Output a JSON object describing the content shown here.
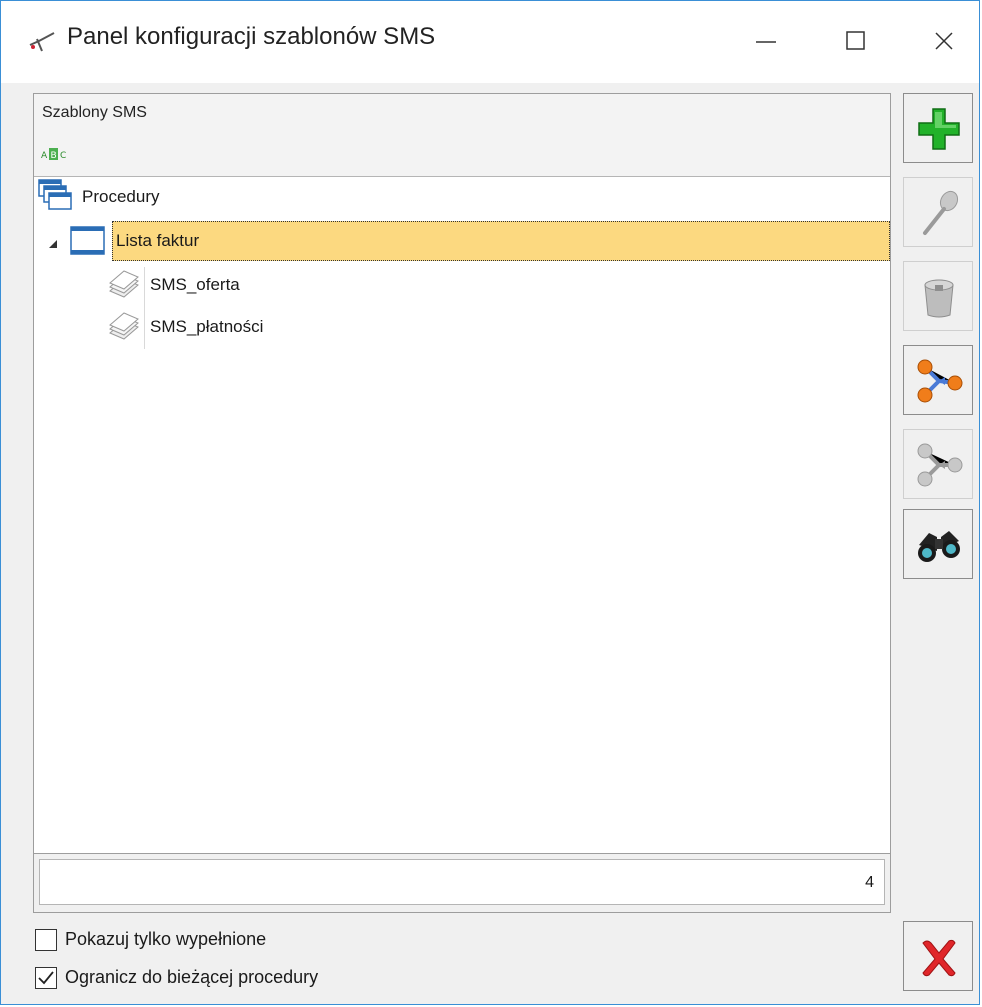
{
  "window": {
    "title": "Panel konfiguracji szablonów SMS"
  },
  "panel": {
    "header": "Szablony SMS",
    "tree": [
      {
        "label": "Procedury",
        "icon": "procedures-icon",
        "level": 0
      },
      {
        "label": "Lista faktur",
        "icon": "window-list-icon",
        "level": 1,
        "selected": true,
        "expanded": true
      },
      {
        "label": "SMS_oferta",
        "icon": "document-stack-icon",
        "level": 2
      },
      {
        "label": "SMS_płatności",
        "icon": "document-stack-icon",
        "level": 2
      }
    ],
    "count": "4"
  },
  "toolbar": [
    {
      "name": "add-button",
      "icon": "green-plus-icon",
      "enabled": true
    },
    {
      "name": "edit-button",
      "icon": "magnifier-icon",
      "enabled": false
    },
    {
      "name": "delete-button",
      "icon": "trash-icon",
      "enabled": false
    },
    {
      "name": "assign-button",
      "icon": "molecule-icon",
      "enabled": true
    },
    {
      "name": "unassign-button",
      "icon": "molecule-gray-icon",
      "enabled": false
    },
    {
      "name": "search-button",
      "icon": "binoculars-icon",
      "enabled": true
    },
    {
      "name": "close-button",
      "icon": "red-x-icon",
      "enabled": true
    }
  ],
  "options": {
    "show_filled_label": "Pokazuj tylko wypełnione",
    "show_filled_checked": false,
    "limit_label": "Ogranicz do bieżącej procedury",
    "limit_checked": true
  },
  "colors": {
    "selection": "#fcd980",
    "accent": "#3a8fd6"
  }
}
